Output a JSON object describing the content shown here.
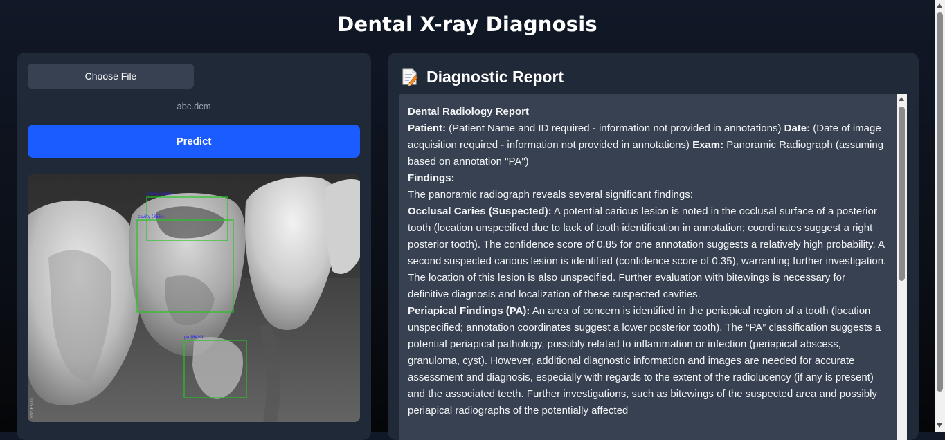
{
  "title": "Dental X-ray Diagnosis",
  "upload": {
    "choose_label": "Choose File",
    "file_name": "abc.dcm",
    "predict_label": "Predict"
  },
  "image": {
    "watermark": "RVG6500",
    "detections": [
      {
        "label": "cavity (85%)"
      },
      {
        "label": "cavity (35%)"
      },
      {
        "label": "pa (84%)"
      }
    ]
  },
  "report": {
    "header": "Diagnostic Report",
    "icon": "memo-icon",
    "heading": "Dental Radiology Report",
    "patient_label": "Patient:",
    "patient_text": " (Patient Name and ID required - information not provided in annotations) ",
    "date_label": "Date:",
    "date_text": " (Date of image acquisition required - information not provided in annotations) ",
    "exam_label": "Exam:",
    "exam_text": " Panoramic Radiograph (assuming based on annotation \"PA\")",
    "findings_label": "Findings:",
    "findings_intro": "The panoramic radiograph reveals several significant findings:",
    "caries_label": "Occlusal Caries (Suspected):",
    "caries_text": " A potential carious lesion is noted in the occlusal surface of a posterior tooth (location unspecified due to lack of tooth identification in annotation; coordinates suggest a right posterior tooth). The confidence score of 0.85 for one annotation suggests a relatively high probability. A second suspected carious lesion is identified (confidence score of 0.35), warranting further investigation. The location of this lesion is also unspecified. Further evaluation with bitewings is necessary for definitive diagnosis and localization of these suspected cavities.",
    "pa_label": "Periapical Findings (PA):",
    "pa_text": " An area of concern is identified in the periapical region of a tooth (location unspecified; annotation coordinates suggest a lower posterior tooth). The “PA” classification suggests a potential periapical pathology, possibly related to inflammation or infection (periapical abscess, granuloma, cyst). However, additional diagnostic information and images are needed for accurate assessment and diagnosis, especially with regards to the extent of the radiolucency (if any is present) and the associated teeth. Further investigations, such as bitewings of the suspected area and possibly periapical radiographs of the potentially affected"
  },
  "colors": {
    "background": "#111827",
    "panel": "#1f2937",
    "report_box": "#374151",
    "predict_button": "#1a5cff",
    "detection_box": "#22c522",
    "detection_label": "#2020ff"
  }
}
